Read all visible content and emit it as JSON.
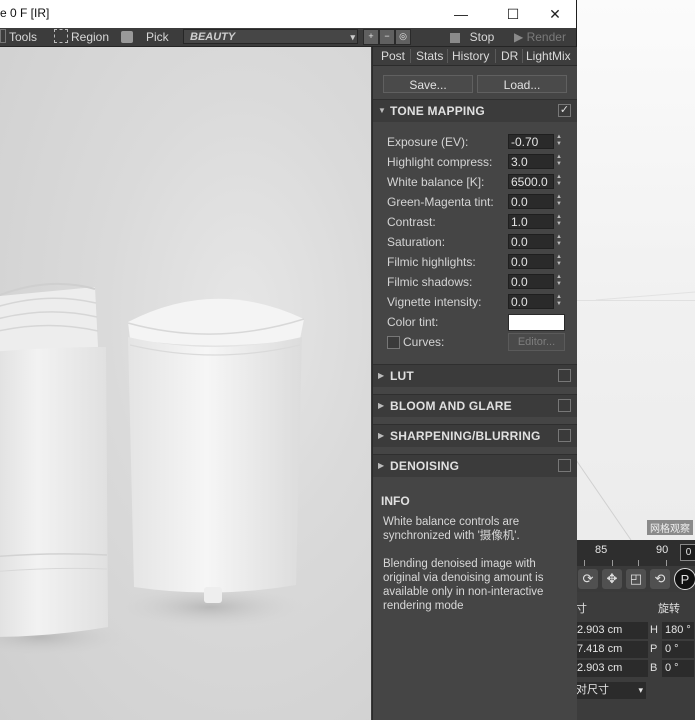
{
  "window": {
    "title": "e 0 F [IR]",
    "controls": {
      "minimize": "—",
      "maximize": "☐",
      "close": "✕"
    }
  },
  "toolbar": {
    "tools": "Tools",
    "region": "Region",
    "pick": "Pick",
    "buffer": "BEAUTY",
    "stop": "Stop",
    "render": "Render"
  },
  "panel": {
    "tabs": [
      "Post",
      "Stats",
      "History",
      "DR",
      "LightMix"
    ],
    "save_label": "Save...",
    "load_label": "Load...",
    "tone_mapping": {
      "title": "TONE MAPPING",
      "enabled": "✓",
      "params": [
        {
          "label": "Exposure (EV):",
          "value": "-0.70"
        },
        {
          "label": "Highlight compress:",
          "value": "3.0"
        },
        {
          "label": "White balance [K]:",
          "value": "6500.0"
        },
        {
          "label": "Green-Magenta tint:",
          "value": "0.0"
        },
        {
          "label": "Contrast:",
          "value": "1.0"
        },
        {
          "label": "Saturation:",
          "value": "0.0"
        },
        {
          "label": "Filmic highlights:",
          "value": "0.0"
        },
        {
          "label": "Filmic shadows:",
          "value": "0.0"
        },
        {
          "label": "Vignette intensity:",
          "value": "0.0"
        }
      ],
      "color_tint_label": "Color tint:",
      "color_tint_value": "#ffffff",
      "curves_label": "Curves:",
      "editor_label": "Editor..."
    },
    "sections": [
      "LUT",
      "BLOOM AND GLARE",
      "SHARPENING/BLURRING",
      "DENOISING"
    ],
    "info": {
      "title": "INFO",
      "text1": "White balance controls are synchronized with '摄像机'.",
      "text2": "Blending denoised image with original via denoising amount is available only in non-interactive rendering mode"
    }
  },
  "host": {
    "viewport_label": "网格观察",
    "ruler": [
      "85",
      "90"
    ],
    "ruler_box": "0",
    "attr_header_left": "寸",
    "attr_header_right": "旋转",
    "rows": [
      {
        "field": "2.903 cm",
        "axis": "H",
        "value": "180 °"
      },
      {
        "field": "7.418 cm",
        "axis": "P",
        "value": "0 °"
      },
      {
        "field": "2.903 cm",
        "axis": "B",
        "value": "0 °"
      }
    ],
    "dropdown": "对尺寸"
  }
}
